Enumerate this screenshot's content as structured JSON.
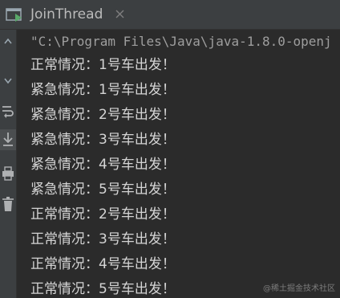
{
  "tab": {
    "title": "JoinThread",
    "icon": "console-run-icon",
    "close_icon": "close-icon"
  },
  "gutter": {
    "icons": [
      "arrow-up-icon",
      "arrow-down-icon",
      "soft-wrap-icon",
      "scroll-to-end-icon",
      "print-icon",
      "delete-icon"
    ]
  },
  "console": {
    "command": "\"C:\\Program Files\\Java\\java-1.8.0-openj",
    "lines": [
      "正常情况：1号车出发！",
      "紧急情况：1号车出发！",
      "紧急情况：2号车出发！",
      "紧急情况：3号车出发！",
      "紧急情况：4号车出发！",
      "紧急情况：5号车出发！",
      "正常情况：2号车出发！",
      "正常情况：3号车出发！",
      "正常情况：4号车出发！",
      "正常情况：5号车出发！"
    ]
  },
  "watermark": "@稀土掘金技术社区",
  "colors": {
    "background": "#2b2b2b",
    "panel": "#3c3f41",
    "text": "#d4d4d4",
    "command_text": "#9e9e9e",
    "tab_text": "#bbbbbb"
  }
}
